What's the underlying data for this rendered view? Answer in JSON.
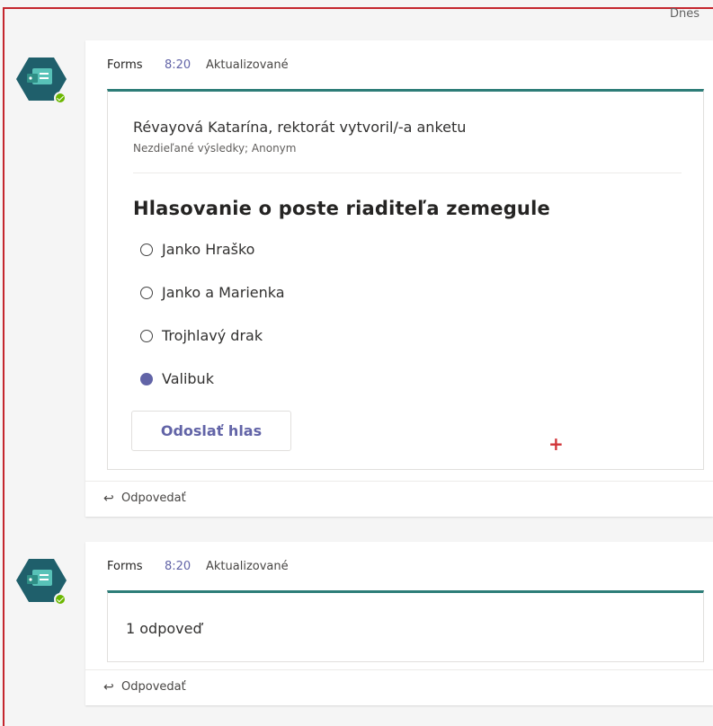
{
  "header": {
    "date_label": "Dnes"
  },
  "posts": [
    {
      "sender": "Forms",
      "time": "8:20",
      "edited": "Aktualizované",
      "card": {
        "creator": "Révayová Katarína, rektorát vytvoril/-a anketu",
        "results": "Nezdieľané výsledky; Anonym",
        "question": "Hlasovanie o poste riaditeľa zemegule",
        "options": [
          {
            "label": "Janko Hraško",
            "selected": false
          },
          {
            "label": "Janko a Marienka",
            "selected": false
          },
          {
            "label": "Trojhlavý drak",
            "selected": false
          },
          {
            "label": "Valibuk",
            "selected": true
          }
        ],
        "submit_label": "Odoslať hlas",
        "marker": "+"
      },
      "reply_label": "Odpovedať",
      "reply_icon": "reply-arrow-icon"
    },
    {
      "sender": "Forms",
      "time": "8:20",
      "edited": "Aktualizované",
      "card": {
        "count": "1 odpoveď"
      },
      "reply_label": "Odpovedať",
      "reply_icon": "reply-arrow-icon"
    }
  ],
  "colors": {
    "accent": "#6264a7",
    "card_border": "#2d7d78",
    "avatar_bg": "#1f5f6b",
    "status": "#6bb700",
    "frame": "#c4262e"
  }
}
